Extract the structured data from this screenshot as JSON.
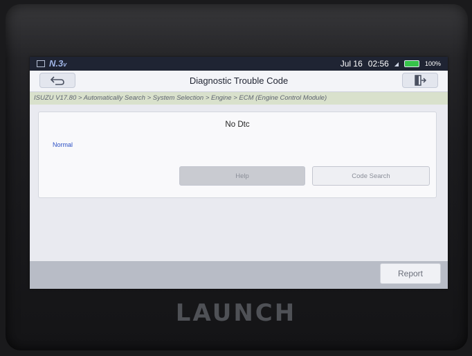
{
  "status_bar": {
    "brand": "N.3",
    "brand_suffix": "v",
    "date": "Jul 16",
    "time": "02:56",
    "battery": "100%",
    "colors": {
      "background": "#1f2433",
      "battery": "#36c24a"
    }
  },
  "header": {
    "title": "Diagnostic Trouble Code",
    "back_icon": "back-arrow-icon",
    "exit_icon": "exit-icon"
  },
  "breadcrumb": "ISUZU V17.80 > Automatically Search > System Selection > Engine > ECM (Engine Control Module)",
  "main": {
    "result_text": "No Dtc",
    "status_text": "Normal",
    "help_label": "Help",
    "code_search_label": "Code Search"
  },
  "footer": {
    "report_label": "Report"
  },
  "device": {
    "logo": "LAUNCH"
  },
  "colors": {
    "status_text": "#2a4fc4",
    "breadcrumb_bg": "#d9e1cc"
  }
}
